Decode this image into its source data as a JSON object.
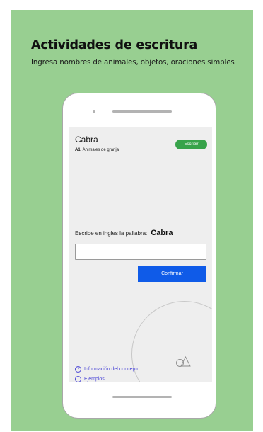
{
  "promo": {
    "title": "Actividades de escritura",
    "subtitle": "Ingresa nombres de animales, objetos, oraciones simples",
    "background_color": "#98cf91"
  },
  "screen": {
    "concept": {
      "title": "Cabra",
      "level": "A1",
      "category": "Animales de granja"
    },
    "write_button_label": "Escribir",
    "prompt": {
      "text": "Escribe en ingles la pallabra:",
      "word": "Cabra"
    },
    "answer_input": {
      "value": "",
      "placeholder": ""
    },
    "confirm_button_label": "Confirmar",
    "links": [
      {
        "icon": "question-icon",
        "glyph": "?",
        "label": "Información del concepto"
      },
      {
        "icon": "info-icon",
        "glyph": "i",
        "label": "Ejemplos"
      }
    ],
    "colors": {
      "accent_green": "#37a34a",
      "primary_blue": "#0f5be8",
      "link_purple": "#4a45d6"
    }
  }
}
